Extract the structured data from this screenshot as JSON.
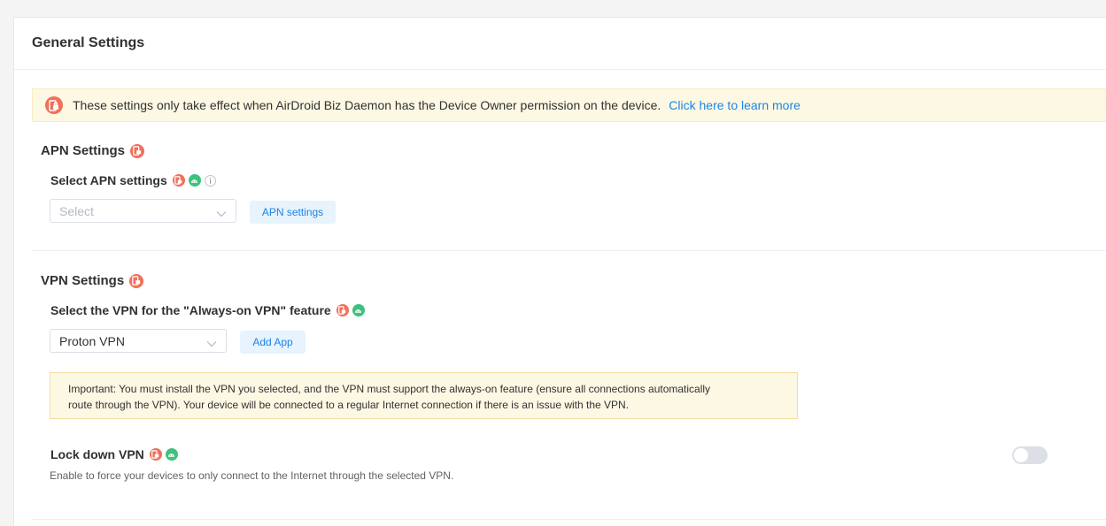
{
  "header": {
    "title": "General Settings"
  },
  "notice": {
    "text": "These settings only take effect when AirDroid Biz Daemon has the Device Owner permission on the device.",
    "link": "Click here to learn more",
    "icon": "lock-phone-icon"
  },
  "apn": {
    "section_title": "APN Settings",
    "field_label": "Select APN settings",
    "select_placeholder": "Select",
    "button_label": "APN settings"
  },
  "vpn": {
    "section_title": "VPN Settings",
    "field_label": "Select the VPN for the \"Always-on VPN\" feature",
    "select_value": "Proton VPN",
    "button_label": "Add App",
    "warning_line1": "Important: You must install the VPN you selected, and the VPN must support the always-on feature (ensure all connections automatically",
    "warning_line2": "route through the VPN). Your device will be connected to a regular Internet connection if there is an issue with the VPN.",
    "lockdown_label": "Lock down VPN",
    "lockdown_desc": "Enable to force your devices to only connect to the Internet through the selected VPN.",
    "lockdown_enabled": false
  },
  "colors": {
    "accent": "#1b85e6",
    "lock_badge": "#f0705a",
    "android_badge": "#3ec17e",
    "notice_bg": "#fdf8e3"
  }
}
